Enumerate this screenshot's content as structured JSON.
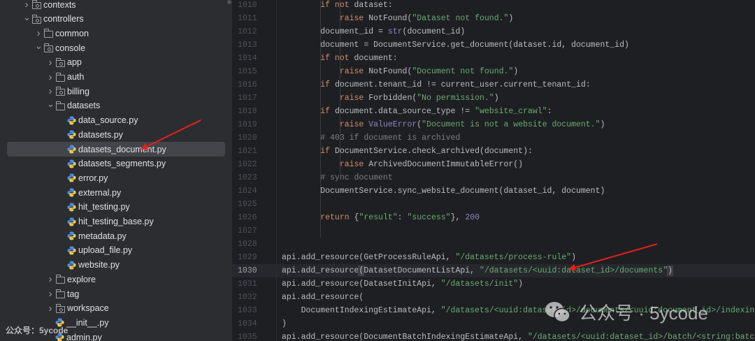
{
  "tree": {
    "items": [
      {
        "label": "contexts",
        "type": "pkg",
        "level": 1,
        "chevron": "right"
      },
      {
        "label": "controllers",
        "type": "pkg",
        "level": 1,
        "chevron": "down"
      },
      {
        "label": "common",
        "type": "folder",
        "level": 2,
        "chevron": "right"
      },
      {
        "label": "console",
        "type": "pkg",
        "level": 2,
        "chevron": "down"
      },
      {
        "label": "app",
        "type": "pkg",
        "level": 3,
        "chevron": "right"
      },
      {
        "label": "auth",
        "type": "folder",
        "level": 3,
        "chevron": "right"
      },
      {
        "label": "billing",
        "type": "pkg",
        "level": 3,
        "chevron": "right"
      },
      {
        "label": "datasets",
        "type": "folder",
        "level": 3,
        "chevron": "down"
      },
      {
        "label": "data_source.py",
        "type": "py",
        "level": 4
      },
      {
        "label": "datasets.py",
        "type": "py",
        "level": 4
      },
      {
        "label": "datasets_document.py",
        "type": "py",
        "level": 4,
        "selected": true
      },
      {
        "label": "datasets_segments.py",
        "type": "py",
        "level": 4
      },
      {
        "label": "error.py",
        "type": "py",
        "level": 4
      },
      {
        "label": "external.py",
        "type": "py",
        "level": 4
      },
      {
        "label": "hit_testing.py",
        "type": "py",
        "level": 4
      },
      {
        "label": "hit_testing_base.py",
        "type": "py",
        "level": 4
      },
      {
        "label": "metadata.py",
        "type": "py",
        "level": 4
      },
      {
        "label": "upload_file.py",
        "type": "py",
        "level": 4
      },
      {
        "label": "website.py",
        "type": "py",
        "level": 4
      },
      {
        "label": "explore",
        "type": "folder",
        "level": 3,
        "chevron": "right"
      },
      {
        "label": "tag",
        "type": "folder",
        "level": 3,
        "chevron": "right"
      },
      {
        "label": "workspace",
        "type": "pkg",
        "level": 3,
        "chevron": "right"
      },
      {
        "label": "__init__.py",
        "type": "py",
        "level": 3
      },
      {
        "label": "admin.py",
        "type": "py",
        "level": 3
      }
    ]
  },
  "editor": {
    "current_line": 1030,
    "lines": [
      {
        "n": "1010",
        "t": [
          [
            "        ",
            ""
          ],
          [
            "if not ",
            "kw"
          ],
          [
            "dataset:",
            ""
          ]
        ]
      },
      {
        "n": "1011",
        "t": [
          [
            "            ",
            ""
          ],
          [
            "raise ",
            "kw"
          ],
          [
            "NotFound(",
            ""
          ],
          [
            "\"Dataset not found.\"",
            "st"
          ],
          [
            ")",
            ""
          ]
        ]
      },
      {
        "n": "1012",
        "t": [
          [
            "        document_id = ",
            ""
          ],
          [
            "str",
            "bi"
          ],
          [
            "(document_id)",
            ""
          ]
        ]
      },
      {
        "n": "1013",
        "t": [
          [
            "        document = DocumentService.get_document(dataset.id, document_id)",
            ""
          ]
        ]
      },
      {
        "n": "1014",
        "t": [
          [
            "        ",
            ""
          ],
          [
            "if not ",
            "kw"
          ],
          [
            "document:",
            ""
          ]
        ]
      },
      {
        "n": "1015",
        "t": [
          [
            "            ",
            ""
          ],
          [
            "raise ",
            "kw"
          ],
          [
            "NotFound(",
            ""
          ],
          [
            "\"Document not found.\"",
            "st"
          ],
          [
            ")",
            ""
          ]
        ]
      },
      {
        "n": "1016",
        "t": [
          [
            "        ",
            ""
          ],
          [
            "if ",
            "kw"
          ],
          [
            "document.tenant_id != current_user.current_tenant_id:",
            ""
          ]
        ]
      },
      {
        "n": "1017",
        "t": [
          [
            "            ",
            ""
          ],
          [
            "raise ",
            "kw"
          ],
          [
            "Forbidden(",
            ""
          ],
          [
            "\"No permission.\"",
            "st"
          ],
          [
            ")",
            ""
          ]
        ]
      },
      {
        "n": "1018",
        "t": [
          [
            "        ",
            ""
          ],
          [
            "if ",
            "kw"
          ],
          [
            "document.data_source_type != ",
            ""
          ],
          [
            "\"website_crawl\"",
            "st"
          ],
          [
            ":",
            ""
          ]
        ]
      },
      {
        "n": "1019",
        "t": [
          [
            "            ",
            ""
          ],
          [
            "raise ",
            "kw"
          ],
          [
            "ValueError",
            "bi"
          ],
          [
            "(",
            ""
          ],
          [
            "\"Document is not a website document.\"",
            "st"
          ],
          [
            ")",
            ""
          ]
        ]
      },
      {
        "n": "1020",
        "t": [
          [
            "        ",
            ""
          ],
          [
            "# 403 if document is archived",
            "cm"
          ]
        ]
      },
      {
        "n": "1021",
        "t": [
          [
            "        ",
            ""
          ],
          [
            "if ",
            "kw"
          ],
          [
            "DocumentService.check_archived(document):",
            ""
          ]
        ]
      },
      {
        "n": "1022",
        "t": [
          [
            "            ",
            ""
          ],
          [
            "raise ",
            "kw"
          ],
          [
            "ArchivedDocumentImmutableError()",
            ""
          ]
        ]
      },
      {
        "n": "1023",
        "t": [
          [
            "        ",
            ""
          ],
          [
            "# sync document",
            "cm"
          ]
        ]
      },
      {
        "n": "1024",
        "t": [
          [
            "        DocumentService.sync_website_document(dataset_id, document)",
            ""
          ]
        ]
      },
      {
        "n": "1025",
        "t": []
      },
      {
        "n": "1026",
        "t": [
          [
            "        ",
            ""
          ],
          [
            "return ",
            "kw"
          ],
          [
            "{",
            ""
          ],
          [
            "\"result\"",
            "st"
          ],
          [
            ": ",
            ""
          ],
          [
            "\"success\"",
            "st"
          ],
          [
            "}, ",
            ""
          ],
          [
            "200",
            "bi"
          ]
        ]
      },
      {
        "n": "1027",
        "t": []
      },
      {
        "n": "1028",
        "t": []
      },
      {
        "n": "1029",
        "t": [
          [
            "api.add_resource(GetProcessRuleApi, ",
            ""
          ],
          [
            "\"/datasets/process-rule\"",
            "st"
          ],
          [
            ")",
            ""
          ]
        ]
      },
      {
        "n": "1030",
        "t": [
          [
            "api.add_resource",
            ""
          ],
          [
            "(",
            "br"
          ],
          [
            "DatasetDocumentListApi, ",
            ""
          ],
          [
            "\"/datasets/<uuid:dataset_id>/documents\"",
            "st"
          ],
          [
            ")",
            "br"
          ]
        ]
      },
      {
        "n": "1031",
        "t": [
          [
            "api.add_resource(DatasetInitApi, ",
            ""
          ],
          [
            "\"/datasets/init\"",
            "st"
          ],
          [
            ")",
            ""
          ]
        ]
      },
      {
        "n": "1032",
        "t": [
          [
            "api.add_resource(",
            ""
          ]
        ]
      },
      {
        "n": "1033",
        "t": [
          [
            "    DocumentIndexingEstimateApi, ",
            ""
          ],
          [
            "\"/datasets/<uuid:dataset_id>/documents/<uuid:document_id>/indexing-estimate\"",
            "st"
          ]
        ]
      },
      {
        "n": "1034",
        "t": [
          [
            ")",
            ""
          ]
        ]
      },
      {
        "n": "1035",
        "t": [
          [
            "api.add_resource(DocumentBatchIndexingEstimateApi, ",
            ""
          ],
          [
            "\"/datasets/<uuid:dataset_id>/batch/<string:batch>/indexing-estimate\"",
            "st"
          ]
        ]
      }
    ]
  },
  "watermark": {
    "text": "公众号 · 5ycode",
    "corner_text": "公众号：5ycode"
  },
  "colors": {
    "arrow": "#e8201c",
    "selection": "#43454a",
    "keyword": "#cf8e6d",
    "string": "#6aab73"
  }
}
